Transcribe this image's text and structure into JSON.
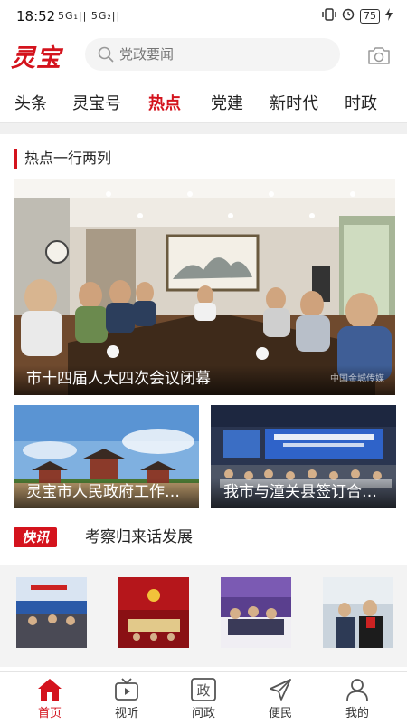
{
  "status_bar": {
    "time": "18:52",
    "signals": "5G₁|| 5G₂||",
    "battery": "75"
  },
  "header": {
    "logo": "灵宝",
    "search_placeholder": "党政要闻"
  },
  "tabs": [
    {
      "label": "头条",
      "active": false
    },
    {
      "label": "灵宝号",
      "active": false
    },
    {
      "label": "热点",
      "active": true
    },
    {
      "label": "党建",
      "active": false
    },
    {
      "label": "新时代",
      "active": false
    },
    {
      "label": "时政",
      "active": false
    }
  ],
  "section": {
    "title": "热点一行两列"
  },
  "hero": {
    "caption": "市十四届人大四次会议闭幕",
    "watermark": "中国金城传媒"
  },
  "cards": [
    {
      "caption": "灵宝市人民政府工作报告"
    },
    {
      "caption": "我市与潼关县签订合作协议"
    }
  ],
  "kuaixun": {
    "badge": "快讯",
    "text": "考察归来话发展"
  },
  "bottom_nav": [
    {
      "label": "首页",
      "icon": "home-icon",
      "active": true
    },
    {
      "label": "视听",
      "icon": "tv-icon",
      "active": false
    },
    {
      "label": "问政",
      "icon": "zheng-icon",
      "active": false
    },
    {
      "label": "便民",
      "icon": "send-icon",
      "active": false
    },
    {
      "label": "我的",
      "icon": "user-icon",
      "active": false
    }
  ],
  "colors": {
    "accent": "#d4131d",
    "gray_background": "#f0f0f0"
  }
}
